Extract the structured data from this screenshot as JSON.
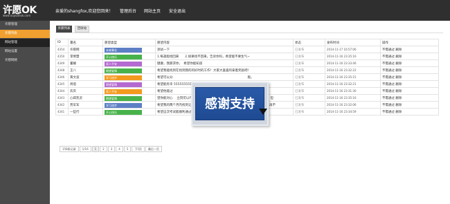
{
  "header": {
    "logo": "许愿OK",
    "logo_sub": "www.xuyuanok.com",
    "welcome": "亲爱的shangfox,欢迎您回来！",
    "links": [
      "管理后台",
      "网站主页",
      "安全退出"
    ]
  },
  "sidebar": {
    "items": [
      "许愿管理",
      "许愿列表",
      "网站管理",
      "网站设置",
      "许愿网络"
    ]
  },
  "tabs": {
    "primary": "许愿列表",
    "secondary": "回收站"
  },
  "table": {
    "headers": [
      "ID",
      "署名",
      "愿望类型",
      "愿望内容",
      "状态",
      "发布时间",
      "操作"
    ],
    "rows": [
      {
        "id": "4354",
        "name": "许愿网",
        "type": "未来事业",
        "content": "测试一下",
        "status": "已发布",
        "time": "2014-11-17 16:57:06",
        "action": "不需通过 删除"
      },
      {
        "id": "4350",
        "name": "李明慧",
        "type": "开心快乐",
        "content": "1.每逢能找回来　　2.如果找不回来，告诉你吗，希望能不要生气~",
        "status": "已发布",
        "time": "2014-11-16 23:35:16",
        "action": "不需通过 删除"
      },
      {
        "id": "4349",
        "name": "董耀",
        "type": "家人平安",
        "content": "健康，我愿求你，　希望你能知道",
        "status": "已发布",
        "time": "2014-11-16 23:33:46",
        "action": "不需通过 删除"
      },
      {
        "id": "4348",
        "name": "王八",
        "type": "期望爱情",
        "content": "希望我能找到在找到我的的好时的工作！大家大喜喜的拿着奖励吧！",
        "status": "已发布",
        "time": "2014-11-16 23:32:22",
        "action": "不需通过 删除"
      },
      {
        "id": "4346",
        "name": "黄文波",
        "type": "学习进步",
        "content": "希望可以分　　　　　　　　　　　　　　　　　　　　　　　　版。",
        "status": "已发布",
        "time": "2014-11-16 23:35:15",
        "action": "不需通过 删除"
      },
      {
        "id": "4345",
        "name": "周倍",
        "type": "期望爱情",
        "content": "希望能有幸 555555555",
        "status": "已发布",
        "time": "2014-11-16 23:32:21",
        "action": "不需通过 删除"
      },
      {
        "id": "4344",
        "name": "庆庆",
        "type": "家人平安",
        "content": "希望他能过",
        "status": "已发布",
        "time": "2014-11-16 23:31:30",
        "action": "不需通过 删除"
      },
      {
        "id": "4343",
        "name": "心碎凯灵",
        "type": "期望爱情",
        "content": "望你能对心 　立刻可以行　　　　　　　　　　　　　　　　　　　　放弃男人，但",
        "status": "已发布",
        "time": "2014-11-16 23:35:16",
        "action": "不需通过 删除"
      },
      {
        "id": "4342",
        "name": "贾军军",
        "type": "学习进步",
        "content": "希望我的两个月内找到让以后好的意思永远感谢我，不要带我说偶然能得的钱嘛！再不",
        "status": "已发布",
        "time": "2014-11-16 23:32:06",
        "action": "不需通过 删除"
      },
      {
        "id": "4341",
        "name": "一些行",
        "type": "开心快乐",
        "content": "希望这次考试能顺利通过",
        "status": "已发布",
        "time": "2014-11-16 23:34:59",
        "action": "不需通过 删除"
      }
    ]
  },
  "pagination": [
    "158条记录",
    "1/16",
    "1",
    "2",
    "3",
    "4",
    "5",
    "下5页",
    "最后一页"
  ],
  "overlay": {
    "text": "感谢支持"
  },
  "colors": {
    "topbar": "#2f2f2f",
    "sidebar": "#4a4a4a",
    "active": "#f0a030",
    "badge_blue": "#5d7fc5",
    "badge_green": "#48b24a",
    "badge_purple": "#b46ad0",
    "badge_orange": "#f39a1e"
  }
}
